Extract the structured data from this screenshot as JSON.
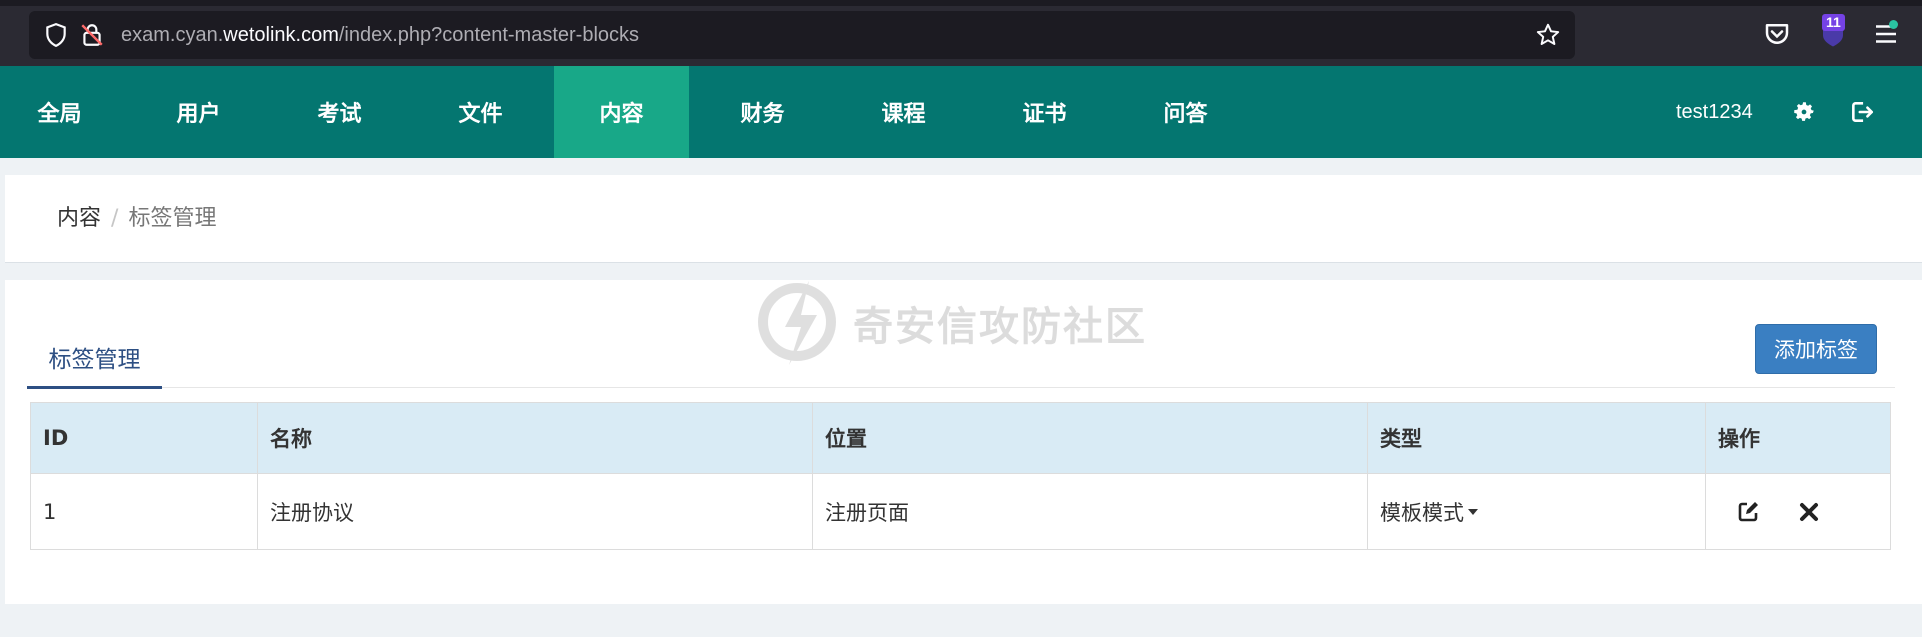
{
  "browser": {
    "url_prefix": "exam.cyan.",
    "url_domain": "wetolink.com",
    "url_path": "/index.php?content-master-blocks",
    "extension_badge": "11"
  },
  "nav": {
    "items": [
      {
        "label": "全局"
      },
      {
        "label": "用户"
      },
      {
        "label": "考试"
      },
      {
        "label": "文件"
      },
      {
        "label": "内容",
        "active": true
      },
      {
        "label": "财务"
      },
      {
        "label": "课程"
      },
      {
        "label": "证书"
      },
      {
        "label": "问答"
      }
    ],
    "username": "test1234"
  },
  "breadcrumb": {
    "parent": "内容",
    "separator": "/",
    "current": "标签管理"
  },
  "panel": {
    "tab_label": "标签管理",
    "add_button": "添加标签",
    "watermark": "奇安信攻防社区"
  },
  "table": {
    "headers": [
      "ID",
      "名称",
      "位置",
      "类型",
      "操作"
    ],
    "rows": [
      {
        "id": "1",
        "name": "注册协议",
        "position": "注册页面",
        "type": "模板模式"
      }
    ]
  },
  "colors": {
    "nav_bg": "#047670",
    "nav_active": "#18a888",
    "primary_button": "#3a7fc2",
    "table_header": "#d9ebf5"
  }
}
